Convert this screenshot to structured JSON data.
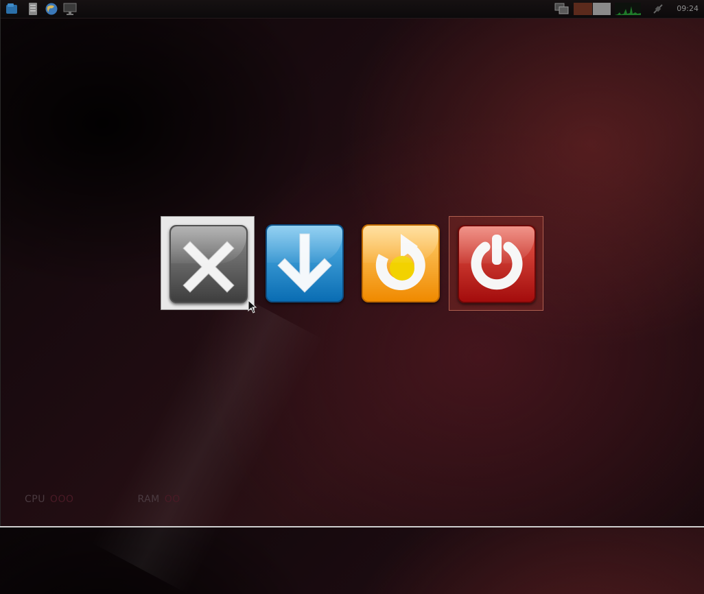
{
  "panel": {
    "clock": "09:24",
    "launchers": [
      {
        "icon": "file-manager-icon"
      },
      {
        "icon": "text-editor-icon"
      },
      {
        "icon": "web-browser-icon"
      },
      {
        "icon": "terminal-monitor-icon"
      }
    ],
    "tray": [
      {
        "icon": "window-list-icon"
      },
      {
        "icon": "workspace-1"
      },
      {
        "icon": "workspace-2"
      },
      {
        "icon": "cpu-graph-icon"
      },
      {
        "icon": "network-plug-icon"
      }
    ]
  },
  "logout_dialog": {
    "buttons": [
      {
        "action": "cancel",
        "icon": "close-x-icon",
        "color": "#6b6b6b"
      },
      {
        "action": "suspend",
        "icon": "arrow-down-icon",
        "color": "#1a86cf"
      },
      {
        "action": "reboot",
        "icon": "reboot-arrow-icon",
        "color": "#f5a300"
      },
      {
        "action": "shutdown",
        "icon": "power-icon",
        "color": "#c71a12"
      }
    ]
  },
  "monitor": {
    "cpu_label": "CPU",
    "cpu_bars": "OOO",
    "ram_label": "RAM",
    "ram_bars": "OO"
  }
}
